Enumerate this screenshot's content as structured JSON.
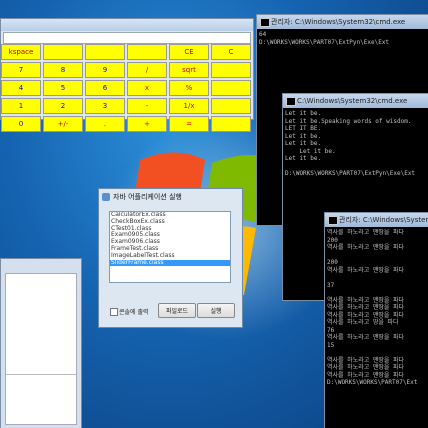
{
  "calculator": {
    "buttons": [
      [
        "kspace",
        "",
        "",
        "",
        "CE",
        "C"
      ],
      [
        "7",
        "8",
        "9",
        "/",
        "sqrt",
        ""
      ],
      [
        "4",
        "5",
        "6",
        "x",
        "%",
        ""
      ],
      [
        "1",
        "2",
        "3",
        "-",
        "1/x",
        ""
      ],
      [
        "0",
        "+/-",
        ".",
        "+",
        "=",
        ""
      ]
    ]
  },
  "cmd_top": {
    "title": "관리자: C:\\Windows\\System32\\cmd.exe",
    "lines": [
      "64",
      "D:\\WORKS\\WORKS\\PART07\\ExtPyn\\Exe\\Ext"
    ]
  },
  "cmd_mid": {
    "title": "C:\\Windows\\System32\\cmd.exe",
    "lines": [
      "Let it be.",
      "Let it be.Speaking words of wisdom.",
      "LET IT BE.",
      "Let it be.",
      "Let it be.",
      "    Let it be.",
      "Let it be.",
      "",
      "D:\\WORKS\\WORKS\\PART07\\ExtPyn\\Exe\\Ext"
    ]
  },
  "cmd_bot": {
    "title": "관리자: C:\\Windows\\System32\\cmd.exe",
    "lines": [
      "역사를 하노라고 맨땅을 파다",
      "200",
      "역사를 하노라고 맨땅을 파다",
      "",
      "200",
      "역사를 하노라고 맨땅을 파다",
      "",
      "37",
      "",
      "역사를 하노라고 맨땅을 파다",
      "역사를 하노라고 맨땅을 파다",
      "역사를 하노라고 맨땅을 파다",
      "역사를 하노라고 땅을 파다",
      "76",
      "역사를 하노라고 맨땅을 파다",
      "15",
      "",
      "역사를 하노라고 맨땅을 파다",
      "역사를 하노라고 맨땅을 파다",
      "역사를 하노라고 맨땅을 파다",
      "D:\\WORKS\\WORKS\\PART07\\Ext"
    ]
  },
  "java_app": {
    "title": "자바 어플리케이션 실행",
    "items": [
      "CalculatorEx.class",
      "CheckBoxEx.class",
      "CTest01.class",
      "Exam0905.class",
      "Exam0906.class",
      "FrameTest.class",
      "ImageLabelTest.class",
      "SliderFrame.class"
    ],
    "selected_index": 7,
    "checkbox_label": "콘솔에 출력",
    "load_button": "파일로드",
    "run_button": "실행"
  },
  "colors": {
    "calc_button_bg": "#ffff00",
    "selection_blue": "#3399ff"
  }
}
